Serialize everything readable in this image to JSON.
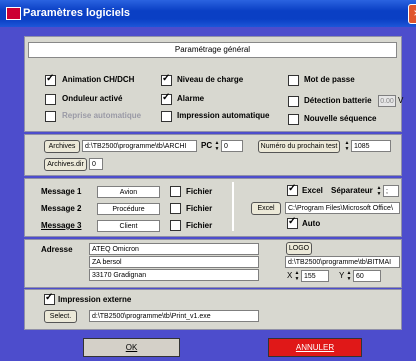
{
  "window": {
    "title": "Paramètres logiciels",
    "close": "×"
  },
  "general": {
    "header": "Paramétrage général",
    "options": [
      {
        "label": "Animation CH/DCH",
        "checked": true
      },
      {
        "label": "Onduleur activé",
        "checked": false
      },
      {
        "label": "Reprise automatique",
        "checked": false,
        "disabled": true
      },
      {
        "label": "Niveau de charge",
        "checked": true
      },
      {
        "label": "Alarme",
        "checked": true
      },
      {
        "label": "Impression automatique",
        "checked": false
      },
      {
        "label": "Mot de passe",
        "checked": false
      },
      {
        "label": "Détection batterie",
        "checked": false
      },
      {
        "label": "Nouvelle séquence",
        "checked": false
      }
    ],
    "battery_value": "0.00",
    "battery_unit": "V"
  },
  "archive": {
    "button": "Archives",
    "path": "d:\\TB2500\\programme\\tb\\ARCHI",
    "pc_label": "PC",
    "pc_value": "0",
    "next_test_button": "Numéro du prochain test",
    "next_test_value": "1085",
    "dir_button": "Archives.dir",
    "dir_value": "0"
  },
  "messages": {
    "items": [
      {
        "label": "Message 1",
        "value": "Avion",
        "fichier": "Fichier"
      },
      {
        "label": "Message 2",
        "value": "Procédure",
        "fichier": "Fichier"
      },
      {
        "label": "Message 3",
        "value": "Client",
        "fichier": "Fichier"
      }
    ]
  },
  "excel": {
    "label": "Excel",
    "separator_label": "Séparateur",
    "separator_value": ";",
    "button": "Excel",
    "path": "C:\\Program Files\\Microsoft Office\\",
    "auto_label": "Auto"
  },
  "address": {
    "label": "Adresse",
    "lines": [
      "ATEQ Omicron",
      "ZA bersol",
      "33170 Gradignan"
    ],
    "logo_button": "LOGO",
    "logo_path": "d:\\TB2500\\programme\\tb\\BITMAI",
    "x_label": "X",
    "x_value": "155",
    "y_label": "Y",
    "y_value": "60"
  },
  "print": {
    "label": "Impression externe",
    "select_button": "Select.",
    "path": "d:\\TB2500\\programme\\tb\\Print_v1.exe"
  },
  "footer": {
    "ok": "OK",
    "cancel": "ANNULER"
  }
}
